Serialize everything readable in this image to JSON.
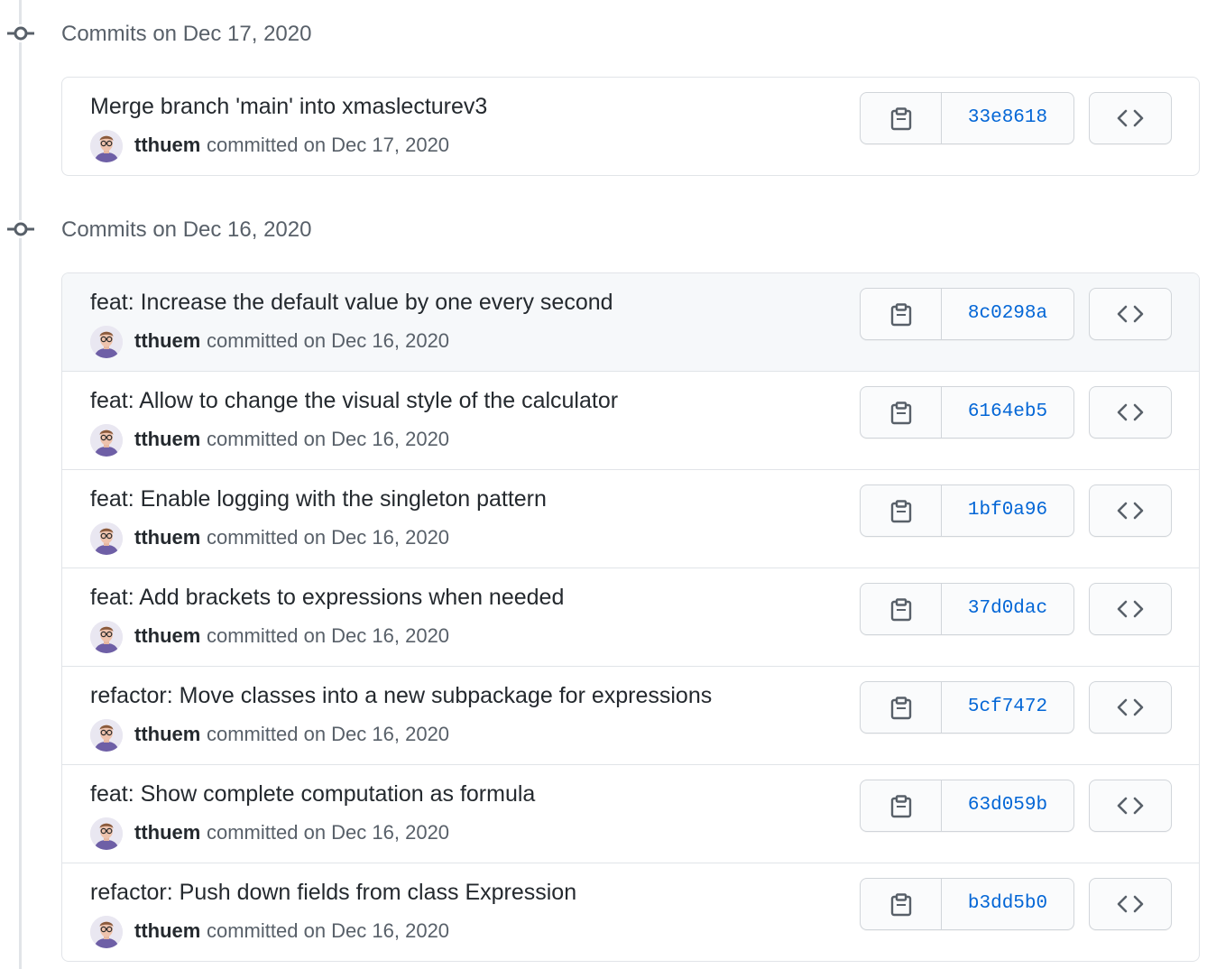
{
  "groups": [
    {
      "header": "Commits on Dec 17, 2020",
      "commits": [
        {
          "title": "Merge branch 'main' into xmaslecturev3",
          "author": "tthuem",
          "committed": "committed on Dec 17, 2020",
          "sha": "33e8618",
          "hover": false
        }
      ]
    },
    {
      "header": "Commits on Dec 16, 2020",
      "commits": [
        {
          "title": "feat: Increase the default value by one every second",
          "author": "tthuem",
          "committed": "committed on Dec 16, 2020",
          "sha": "8c0298a",
          "hover": true
        },
        {
          "title": "feat: Allow to change the visual style of the calculator",
          "author": "tthuem",
          "committed": "committed on Dec 16, 2020",
          "sha": "6164eb5",
          "hover": false
        },
        {
          "title": "feat: Enable logging with the singleton pattern",
          "author": "tthuem",
          "committed": "committed on Dec 16, 2020",
          "sha": "1bf0a96",
          "hover": false
        },
        {
          "title": "feat: Add brackets to expressions when needed",
          "author": "tthuem",
          "committed": "committed on Dec 16, 2020",
          "sha": "37d0dac",
          "hover": false
        },
        {
          "title": "refactor: Move classes into a new subpackage for expressions",
          "author": "tthuem",
          "committed": "committed on Dec 16, 2020",
          "sha": "5cf7472",
          "hover": false
        },
        {
          "title": "feat: Show complete computation as formula",
          "author": "tthuem",
          "committed": "committed on Dec 16, 2020",
          "sha": "63d059b",
          "hover": false
        },
        {
          "title": "refactor: Push down fields from class Expression",
          "author": "tthuem",
          "committed": "committed on Dec 16, 2020",
          "sha": "b3dd5b0",
          "hover": false
        }
      ]
    }
  ],
  "icons": {
    "timeline": "git-commit-icon",
    "copy": "clipboard-icon",
    "browse": "code-icon",
    "avatar": "avatar"
  },
  "colors": {
    "link": "#0366d6",
    "muted": "#586069",
    "border": "#e1e4e8",
    "hover_row": "#f6f8fa"
  }
}
